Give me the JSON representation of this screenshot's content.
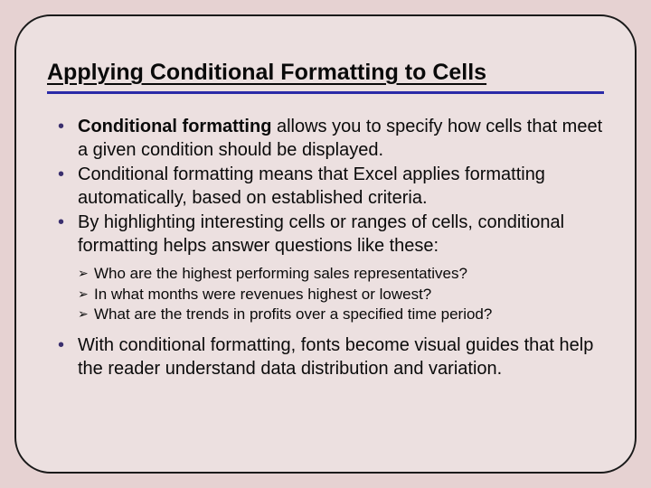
{
  "title": "Applying Conditional Formatting to Cells",
  "bullets": {
    "b1_bold": "Conditional formatting",
    "b1_rest": " allows you to specify how cells that meet a given condition should be displayed.",
    "b2": "Conditional formatting means that Excel applies formatting automatically, based on established criteria.",
    "b3": "By highlighting interesting cells or ranges of cells, conditional formatting helps answer questions like these:",
    "b4": "With conditional formatting, fonts become visual guides that help the reader understand data distribution and variation."
  },
  "sub": {
    "s1": "Who are the highest performing sales representatives?",
    "s2": "In what months were revenues highest or lowest?",
    "s3": "What are the trends in profits over a specified time period?"
  }
}
